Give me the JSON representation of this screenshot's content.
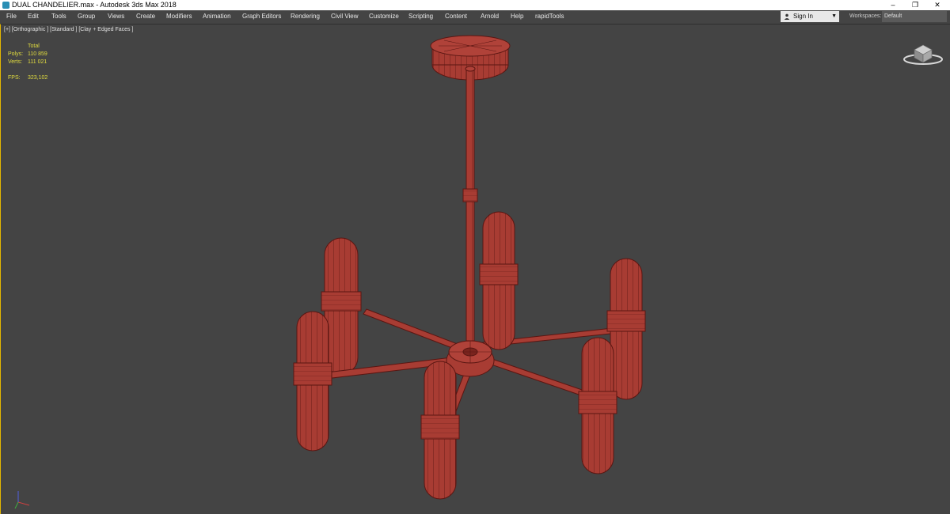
{
  "window": {
    "title": "DUAL CHANDELIER.max - Autodesk 3ds Max 2018",
    "minimize": "–",
    "restore": "❐",
    "close": "✕"
  },
  "menu": [
    "File",
    "Edit",
    "Tools",
    "Group",
    "Views",
    "Create",
    "Modifiers",
    "Animation",
    "Graph Editors",
    "Rendering",
    "Civil View",
    "Customize",
    "Scripting",
    "Content",
    "Arnold",
    "Help",
    "rapidTools"
  ],
  "account": {
    "signin_label": "Sign In"
  },
  "workspaces": {
    "label": "Workspaces:",
    "value": "Default"
  },
  "viewport": {
    "label": "[+] [Orthographic ] [Standard ] [Clay + Edged Faces ]",
    "stats": {
      "header": "Total",
      "polys_label": "Polys:",
      "polys_value": "110 859",
      "verts_label": "Verts:",
      "verts_value": "111 021",
      "fps_label": "FPS:",
      "fps_value": "323,102"
    }
  },
  "colors": {
    "model_fill": "#a83c33",
    "model_edge": "#5a1612",
    "stats_text": "#e1dc3f",
    "viewport_bg": "#444444",
    "active_border": "#e3b600"
  }
}
